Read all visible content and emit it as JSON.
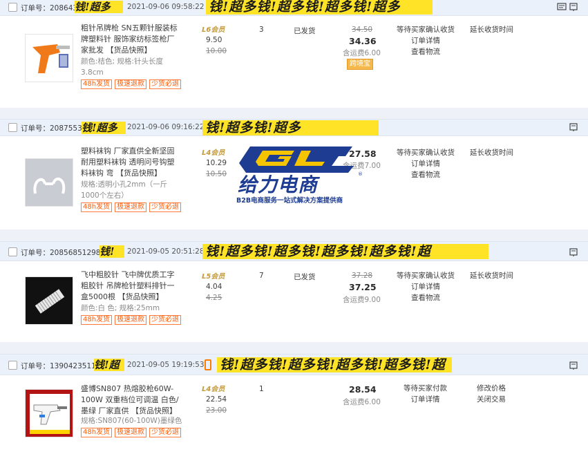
{
  "orders": [
    {
      "order_label": "订单号：",
      "order_no": "208643",
      "time": "2021-09-06 09:58:22",
      "watermark": "钱!超多钱!超多钱!超多钱!超多",
      "product_title": "粗针吊牌枪 SN五颗针服装标牌塑料针 服饰家纺标签枪厂家批发 【货品快照】",
      "spec": "颜色:桔色; 规格:针头长度3.8cm",
      "tags": [
        "48h发货",
        "极速退款",
        "少货必退"
      ],
      "vip": "L6会员",
      "price": "9.50",
      "price_old": "10.00",
      "qty": "3",
      "ship_status": "已发货",
      "total_old": "34.50",
      "total": "34.36",
      "freight": "含运费6.00",
      "badge": "跨境宝",
      "status_main": "等待买家确认收货",
      "links": [
        "订单详情",
        "查看物流"
      ],
      "extend": "延长收货时间"
    },
    {
      "order_label": "订单号：",
      "order_no": "20875532",
      "time": "2021-09-06 09:16:22",
      "watermark": "钱!超多钱!超多",
      "product_title": "塑料袜钩 厂家直供全新坚固耐用塑料袜钩 透明问号钩塑料袜钩 弯 【货品快照】",
      "spec": "规格:透明小孔2mm（一斤1000个左右）",
      "tags": [
        "48h发货",
        "极速退款",
        "少货必退"
      ],
      "vip": "L4会员",
      "price": "10.29",
      "price_old": "10.50",
      "qty": "",
      "ship_status": "",
      "total_old": "",
      "total": "27.58",
      "freight": "含运费7.00",
      "badge": "",
      "status_main": "等待买家确认收货",
      "links": [
        "订单详情",
        "查看物流"
      ],
      "extend": "延长收货时间"
    },
    {
      "order_label": "订单号：",
      "order_no": "2085685129868",
      "time": "2021-09-05 20:51:28",
      "watermark": "钱!超多钱!超多钱!超多钱!超多钱!超",
      "product_title": "飞中粗胶针 飞中牌优质工字粗胶针 吊牌枪针塑料排针一盒5000根 【货品快照】",
      "spec": "颜色:白 色; 规格:25mm",
      "tags": [
        "48h发货",
        "极速退款",
        "少货必退"
      ],
      "vip": "L5会员",
      "price": "4.04",
      "price_old": "4.25",
      "qty": "7",
      "ship_status": "已发货",
      "total_old": "37.28",
      "total": "37.25",
      "freight": "含运费9.00",
      "badge": "",
      "status_main": "等待买家确认收货",
      "links": [
        "订单详情",
        "查看物流"
      ],
      "extend": "延长收货时间"
    },
    {
      "order_label": "订单号：",
      "order_no": "1390423511",
      "time": "2021-09-05 19:19:53",
      "watermark": "钱!超多钱!超多钱!超多钱!超多钱!超",
      "product_title": "盛博SN807 热熔胶枪60W-100W 双重档位可调温 白色/墨绿 厂家直供 【货品快照】",
      "spec": "规格:SN807(60-100W)墨绿色",
      "tags": [
        "48h发货",
        "极速退款",
        "少货必退"
      ],
      "vip": "L4会员",
      "price": "22.54",
      "price_old": "23.00",
      "qty": "1",
      "ship_status": "",
      "total_old": "",
      "total": "28.54",
      "freight": "含运费6.00",
      "badge": "",
      "status_main": "等待买家付款",
      "links": [
        "订单详情"
      ],
      "extend_links": [
        "修改价格",
        "关闭交易"
      ]
    }
  ],
  "logo": {
    "cn_name": "给力电商",
    "slogan": "B2B电商服务一站式解决方案提供商",
    "mark": "GL",
    "registered": "®",
    "brand_color": "#1d3c92",
    "accent_color": "#f5c400"
  },
  "icons": [
    "message-icon",
    "flag-icon",
    "phone-icon"
  ]
}
